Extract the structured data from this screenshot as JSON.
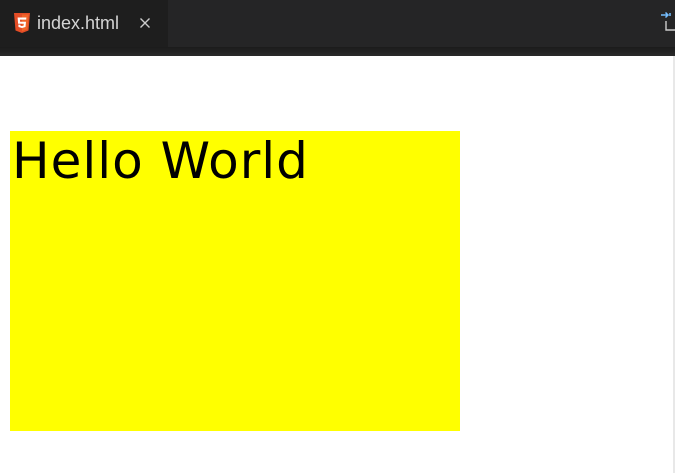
{
  "editor": {
    "tab": {
      "label": "index.html",
      "icon": "html5-icon",
      "close_icon": "close-icon"
    },
    "actions": {
      "split_icon": "split-editor-icon"
    }
  },
  "preview": {
    "text": "Hello World",
    "box_color": "#ffff00",
    "text_color": "#000000"
  },
  "colors": {
    "tabbar_bg": "#252526",
    "active_tab_bg": "#1e1e1e",
    "tab_text": "#d4d4d4",
    "html5_orange": "#e44d26"
  }
}
